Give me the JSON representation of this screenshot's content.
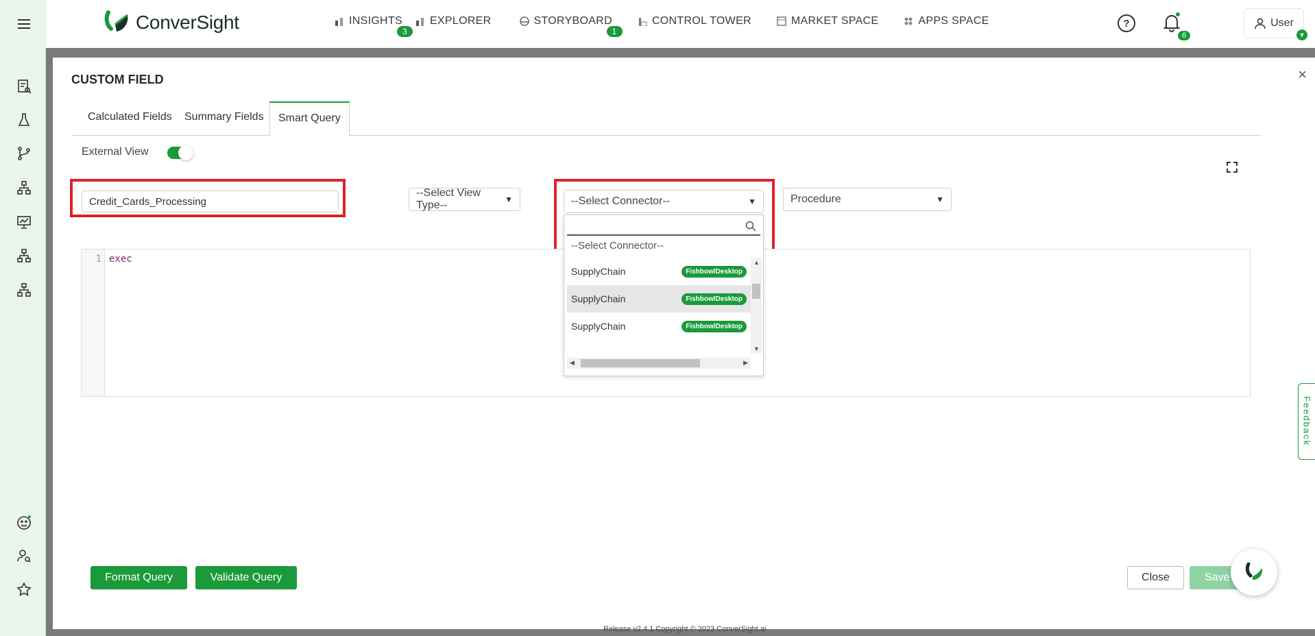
{
  "app": {
    "brand": "ConverSight"
  },
  "nav": {
    "items": [
      {
        "label": "INSIGHTS",
        "badge": "3"
      },
      {
        "label": "EXPLORER",
        "badge": ""
      },
      {
        "label": "STORYBOARD",
        "badge": "1"
      },
      {
        "label": "CONTROL TOWER",
        "badge": ""
      },
      {
        "label": "MARKET SPACE",
        "badge": ""
      },
      {
        "label": "APPS SPACE",
        "badge": ""
      }
    ],
    "notifications_count": "6",
    "user_label": "User"
  },
  "modal": {
    "title": "CUSTOM FIELD",
    "close_glyph": "×",
    "tabs": [
      "Calculated Fields",
      "Summary Fields",
      "Smart Query"
    ],
    "active_tab": "Smart Query",
    "external_view_label": "External View",
    "external_view_on": true,
    "view_name": "Credit_Cards_Processing",
    "view_type_placeholder": "--Select View Type--",
    "connector_placeholder": "--Select Connector--",
    "procedure_value": "Procedure",
    "editor": {
      "line_number": "1",
      "code": "exec"
    },
    "connector_dropdown": {
      "search_value": "",
      "placeholder_option": "--Select Connector--",
      "options": [
        {
          "name": "SupplyChain",
          "tag": "FishbowlDesktop"
        },
        {
          "name": "SupplyChain",
          "tag": "FishbowlDesktop"
        },
        {
          "name": "SupplyChain",
          "tag": "FishbowlDesktop"
        }
      ]
    },
    "buttons": {
      "format": "Format Query",
      "validate": "Validate Query",
      "close": "Close",
      "save": "Save"
    }
  },
  "feedback_label": "Feedback",
  "footer_text": "Release v2.4.1 Copyright © 2023 ConverSight.ai",
  "colors": {
    "accent": "#1a9a3a",
    "highlight": "#e0202e",
    "sidebar_bg": "#eaf5ec"
  }
}
